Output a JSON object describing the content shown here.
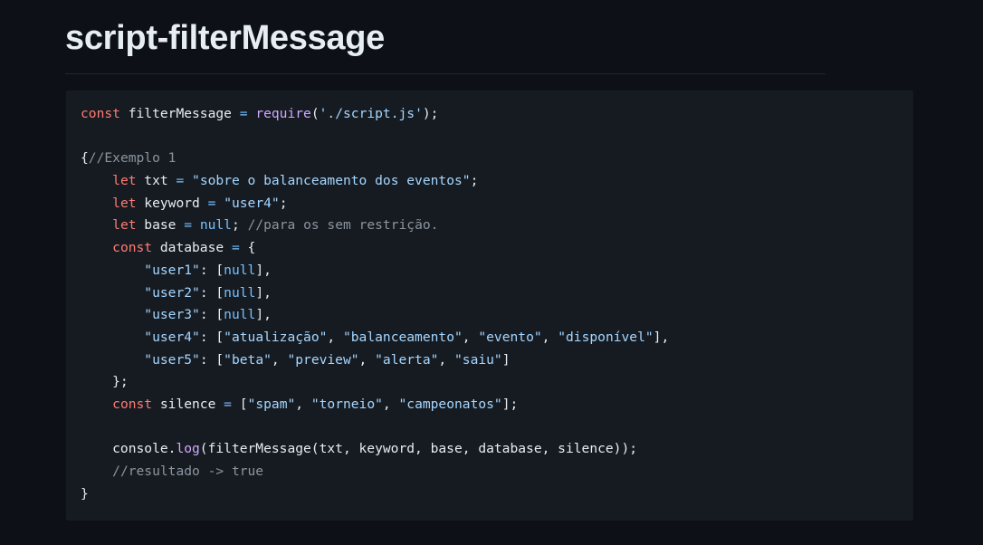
{
  "page": {
    "title": "script-filterMessage"
  },
  "code": {
    "lines": [
      [
        [
          "kw",
          "const"
        ],
        [
          "pl",
          " filterMessage "
        ],
        [
          "op",
          "="
        ],
        [
          "pl",
          " "
        ],
        [
          "fn",
          "require"
        ],
        [
          "pl",
          "("
        ],
        [
          "str",
          "'./script.js'"
        ],
        [
          "pl",
          ");"
        ]
      ],
      [],
      [
        [
          "pl",
          "{"
        ],
        [
          "cmt",
          "//Exemplo 1"
        ]
      ],
      [
        [
          "pl",
          "    "
        ],
        [
          "kw",
          "let"
        ],
        [
          "pl",
          " txt "
        ],
        [
          "op",
          "="
        ],
        [
          "pl",
          " "
        ],
        [
          "str",
          "\"sobre o balanceamento dos eventos\""
        ],
        [
          "pl",
          ";"
        ]
      ],
      [
        [
          "pl",
          "    "
        ],
        [
          "kw",
          "let"
        ],
        [
          "pl",
          " keyword "
        ],
        [
          "op",
          "="
        ],
        [
          "pl",
          " "
        ],
        [
          "str",
          "\"user4\""
        ],
        [
          "pl",
          ";"
        ]
      ],
      [
        [
          "pl",
          "    "
        ],
        [
          "kw",
          "let"
        ],
        [
          "pl",
          " base "
        ],
        [
          "op",
          "="
        ],
        [
          "pl",
          " "
        ],
        [
          "num",
          "null"
        ],
        [
          "pl",
          "; "
        ],
        [
          "cmt",
          "//para os sem restrição."
        ]
      ],
      [
        [
          "pl",
          "    "
        ],
        [
          "kw",
          "const"
        ],
        [
          "pl",
          " database "
        ],
        [
          "op",
          "="
        ],
        [
          "pl",
          " {"
        ]
      ],
      [
        [
          "pl",
          "        "
        ],
        [
          "str",
          "\"user1\""
        ],
        [
          "pl",
          ": ["
        ],
        [
          "num",
          "null"
        ],
        [
          "pl",
          "],"
        ]
      ],
      [
        [
          "pl",
          "        "
        ],
        [
          "str",
          "\"user2\""
        ],
        [
          "pl",
          ": ["
        ],
        [
          "num",
          "null"
        ],
        [
          "pl",
          "],"
        ]
      ],
      [
        [
          "pl",
          "        "
        ],
        [
          "str",
          "\"user3\""
        ],
        [
          "pl",
          ": ["
        ],
        [
          "num",
          "null"
        ],
        [
          "pl",
          "],"
        ]
      ],
      [
        [
          "pl",
          "        "
        ],
        [
          "str",
          "\"user4\""
        ],
        [
          "pl",
          ": ["
        ],
        [
          "str",
          "\"atualização\""
        ],
        [
          "pl",
          ", "
        ],
        [
          "str",
          "\"balanceamento\""
        ],
        [
          "pl",
          ", "
        ],
        [
          "str",
          "\"evento\""
        ],
        [
          "pl",
          ", "
        ],
        [
          "str",
          "\"disponível\""
        ],
        [
          "pl",
          "],"
        ]
      ],
      [
        [
          "pl",
          "        "
        ],
        [
          "str",
          "\"user5\""
        ],
        [
          "pl",
          ": ["
        ],
        [
          "str",
          "\"beta\""
        ],
        [
          "pl",
          ", "
        ],
        [
          "str",
          "\"preview\""
        ],
        [
          "pl",
          ", "
        ],
        [
          "str",
          "\"alerta\""
        ],
        [
          "pl",
          ", "
        ],
        [
          "str",
          "\"saiu\""
        ],
        [
          "pl",
          "]"
        ]
      ],
      [
        [
          "pl",
          "    };"
        ]
      ],
      [
        [
          "pl",
          "    "
        ],
        [
          "kw",
          "const"
        ],
        [
          "pl",
          " silence "
        ],
        [
          "op",
          "="
        ],
        [
          "pl",
          " ["
        ],
        [
          "str",
          "\"spam\""
        ],
        [
          "pl",
          ", "
        ],
        [
          "str",
          "\"torneio\""
        ],
        [
          "pl",
          ", "
        ],
        [
          "str",
          "\"campeonatos\""
        ],
        [
          "pl",
          "];"
        ]
      ],
      [],
      [
        [
          "pl",
          "    console."
        ],
        [
          "fn",
          "log"
        ],
        [
          "pl",
          "(filterMessage(txt, keyword, base, database, silence));"
        ]
      ],
      [
        [
          "pl",
          "    "
        ],
        [
          "cmt",
          "//resultado -> true"
        ]
      ],
      [
        [
          "pl",
          "}"
        ]
      ]
    ]
  }
}
